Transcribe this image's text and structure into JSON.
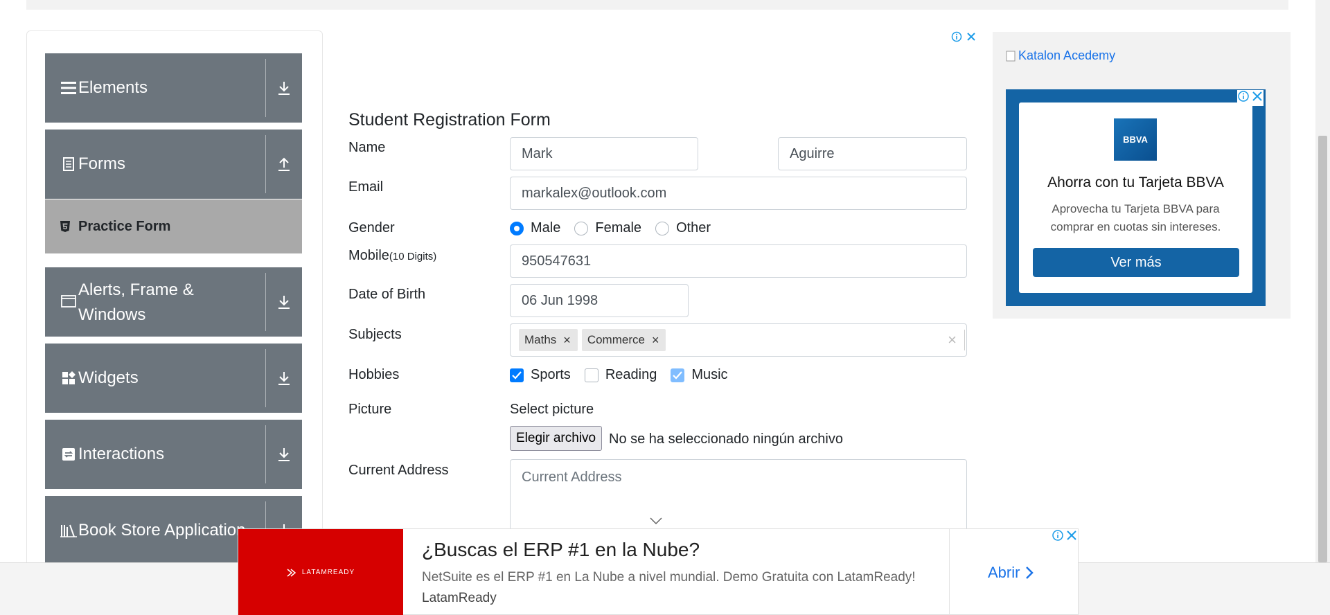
{
  "sidebar": {
    "groups": [
      {
        "label": "Elements",
        "icon": "menu-icon",
        "toggle": "download-icon"
      },
      {
        "label": "Forms",
        "icon": "document-icon",
        "toggle": "upload-icon"
      },
      {
        "label": "Alerts, Frame & Windows",
        "icon": "window-icon",
        "toggle": "download-icon"
      },
      {
        "label": "Widgets",
        "icon": "widgets-icon",
        "toggle": "download-icon"
      },
      {
        "label": "Interactions",
        "icon": "interactions-icon",
        "toggle": "download-icon"
      },
      {
        "label": "Book Store Application",
        "icon": "books-icon",
        "toggle": "download-icon"
      }
    ],
    "active_item": {
      "label": "Practice Form",
      "icon": "html5-icon"
    }
  },
  "form": {
    "title": "Student Registration Form",
    "name_label": "Name",
    "first_name": "Mark",
    "last_name": "Aguirre",
    "email_label": "Email",
    "email": "markalex@outlook.com",
    "gender_label": "Gender",
    "genders": [
      "Male",
      "Female",
      "Other"
    ],
    "gender_selected": "Male",
    "mobile_label": "Mobile",
    "mobile_hint": "(10 Digits)",
    "mobile": "950547631",
    "dob_label": "Date of Birth",
    "dob": "06 Jun 1998",
    "subjects_label": "Subjects",
    "subjects": [
      "Maths",
      "Commerce"
    ],
    "hobbies_label": "Hobbies",
    "hobbies": [
      {
        "label": "Sports",
        "checked": true
      },
      {
        "label": "Reading",
        "checked": false
      },
      {
        "label": "Music",
        "checked": true
      }
    ],
    "picture_label": "Picture",
    "picture_prompt": "Select picture",
    "file_button": "Elegir archivo",
    "file_status": "No se ha seleccionado ningún archivo",
    "address_label": "Current Address",
    "address_placeholder": "Current Address"
  },
  "right_ad": {
    "katalon_alt": "Katalon Acedemy",
    "bbva_logo": "BBVA",
    "headline": "Ahorra con tu Tarjeta BBVA",
    "body": "Aprovecha tu Tarjeta BBVA para comprar en cuotas sin intereses.",
    "cta": "Ver más",
    "brand_color": "#1464a5"
  },
  "bottom_ad": {
    "logo_text": "LATAMREADY",
    "headline": "¿Buscas el ERP #1 en la Nube?",
    "description": "NetSuite es el ERP #1 en La Nube a nivel mundial. Demo Gratuita con LatamReady!",
    "advertiser": "LatamReady",
    "cta": "Abrir",
    "accent": "#d60000"
  },
  "colors": {
    "sidebar_group": "#6c757d",
    "active_item": "#a9a9a9",
    "primary": "#007bff"
  }
}
